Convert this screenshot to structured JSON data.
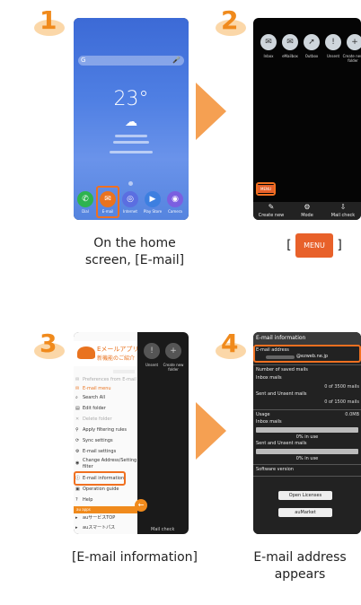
{
  "steps": [
    {
      "number": "1",
      "caption_line1": "On the home",
      "caption_line2": "screen, [E-mail]"
    },
    {
      "number": "2",
      "caption_prefix": "[",
      "caption_suffix": "]",
      "menu_label": "MENU"
    },
    {
      "number": "3",
      "caption_line1": "[E-mail information]"
    },
    {
      "number": "4",
      "caption_line1": "E-mail address",
      "caption_line2": "appears"
    }
  ],
  "phone1": {
    "search_glyph": "G",
    "mic_glyph": "🎤",
    "time": "23°",
    "weather_glyph": "☁",
    "dock": [
      {
        "label": "Dial",
        "icon": "phone-icon",
        "color": "#2eb34f",
        "glyph": "✆"
      },
      {
        "label": "E-mail",
        "icon": "email-icon",
        "color": "#e9731f",
        "glyph": "✉"
      },
      {
        "label": "Internet",
        "icon": "internet-icon",
        "color": "#5b6ee1",
        "glyph": "◎"
      },
      {
        "label": "Play Store",
        "icon": "play-store-icon",
        "color": "#3d7fe0",
        "glyph": "▶"
      },
      {
        "label": "Camera",
        "icon": "camera-icon",
        "color": "#7b5fe0",
        "glyph": "◉"
      }
    ]
  },
  "phone2": {
    "folders": [
      {
        "label": "Inbox",
        "icon": "inbox-icon"
      },
      {
        "label": "eMailbox",
        "icon": "emailbox-icon"
      },
      {
        "label": "Outbox",
        "icon": "outbox-icon"
      },
      {
        "label": "Unsent",
        "icon": "unsent-icon"
      },
      {
        "label": "Create new folder",
        "icon": "create-folder-icon"
      }
    ],
    "bottom": [
      {
        "label": "Create new",
        "icon": "compose-icon"
      },
      {
        "label": "Mode",
        "icon": "mode-icon"
      },
      {
        "label": "Mail check",
        "icon": "mail-check-icon"
      }
    ],
    "menu_button": "MENU"
  },
  "phone3": {
    "banner_line1": "Eメールアプリ",
    "banner_line2": "新機能のご紹介",
    "items": [
      {
        "label": "Preferences from E-mail",
        "icon": "envelope-icon",
        "faded": true
      },
      {
        "label": "E-mail menu",
        "icon": "email-menu-icon",
        "faded": false
      },
      {
        "label": "Search All",
        "icon": "search-icon",
        "faded": false
      },
      {
        "label": "Edit folder",
        "icon": "folder-icon",
        "faded": false
      },
      {
        "label": "Delete folder",
        "icon": "trash-icon",
        "faded": true
      },
      {
        "label": "Apply filtering rules",
        "icon": "filter-icon",
        "faded": false
      },
      {
        "label": "Sync settings",
        "icon": "sync-icon",
        "faded": false
      },
      {
        "label": "E-mail settings",
        "icon": "settings-icon",
        "faded": false
      },
      {
        "label": "Change Address/Setting filter",
        "icon": "address-icon",
        "faded": false
      },
      {
        "label": "E-mail information",
        "icon": "info-icon",
        "faded": false
      },
      {
        "label": "Operation guide",
        "icon": "guide-icon",
        "faded": false
      },
      {
        "label": "Help",
        "icon": "help-icon",
        "faded": false
      }
    ],
    "section_label": "au apps",
    "apps": [
      {
        "label": "auサービスTOP",
        "icon": "au-service-icon"
      },
      {
        "label": "auスマートパス",
        "icon": "au-smartpass-icon"
      }
    ],
    "right_labels": [
      "Unsent",
      "Create new folder"
    ],
    "bottom_label": "Mail check"
  },
  "phone4": {
    "header": "E-mail information",
    "address_label": "E-mail address",
    "address_value": "@ezweb.ne.jp",
    "saved_label": "Number of saved mails",
    "inbox_label": "Inbox mails",
    "inbox_value": "0 of 3500 mails",
    "sent_label": "Sent and Unsent mails",
    "sent_value": "0 of 1500 mails",
    "usage_label": "Usage",
    "usage_value": "0.0MB",
    "usage_inbox_label": "Inbox mails",
    "usage_inbox_pct": "0% in use",
    "usage_sent_label": "Sent and Unsent mails",
    "usage_sent_pct": "0% in use",
    "software_label": "Software version",
    "open_licenses": "Open Licenses",
    "aumarket": "auMarket"
  },
  "colors": {
    "accent": "#f08a1c",
    "highlight": "#f07020",
    "arrow": "#f5a052"
  }
}
